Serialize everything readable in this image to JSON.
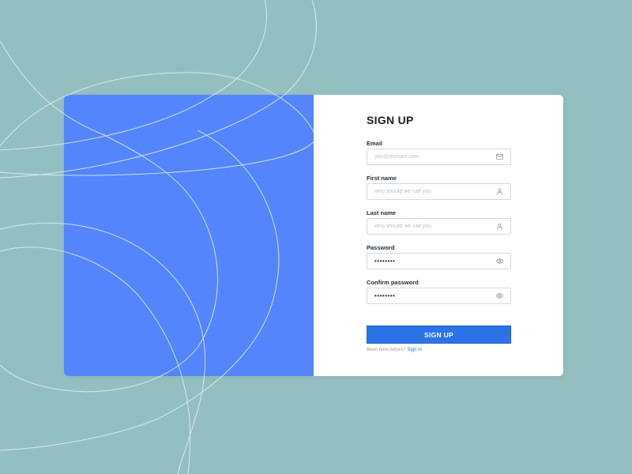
{
  "form": {
    "title": "SIGN UP",
    "fields": {
      "email": {
        "label": "Email",
        "placeholder": "you@domain.com",
        "value": "",
        "icon": "mail-icon"
      },
      "first_name": {
        "label": "First name",
        "placeholder": "who should we call you",
        "value": "",
        "icon": "user-icon"
      },
      "last_name": {
        "label": "Last name",
        "placeholder": "who should we call you",
        "value": "",
        "icon": "user-icon"
      },
      "password": {
        "label": "Password",
        "value": "••••••••",
        "icon": "eye-icon"
      },
      "confirm_password": {
        "label": "Confirm password",
        "value": "••••••••",
        "icon": "eye-icon"
      }
    },
    "submit_label": "SIGN UP",
    "signin_prompt": "Been here before?",
    "signin_link": "Sign In"
  },
  "colors": {
    "background": "#93bec0",
    "panel_accent": "#5585fc",
    "button": "#2b73e6",
    "link": "#2b73e6",
    "card": "#ffffff"
  }
}
